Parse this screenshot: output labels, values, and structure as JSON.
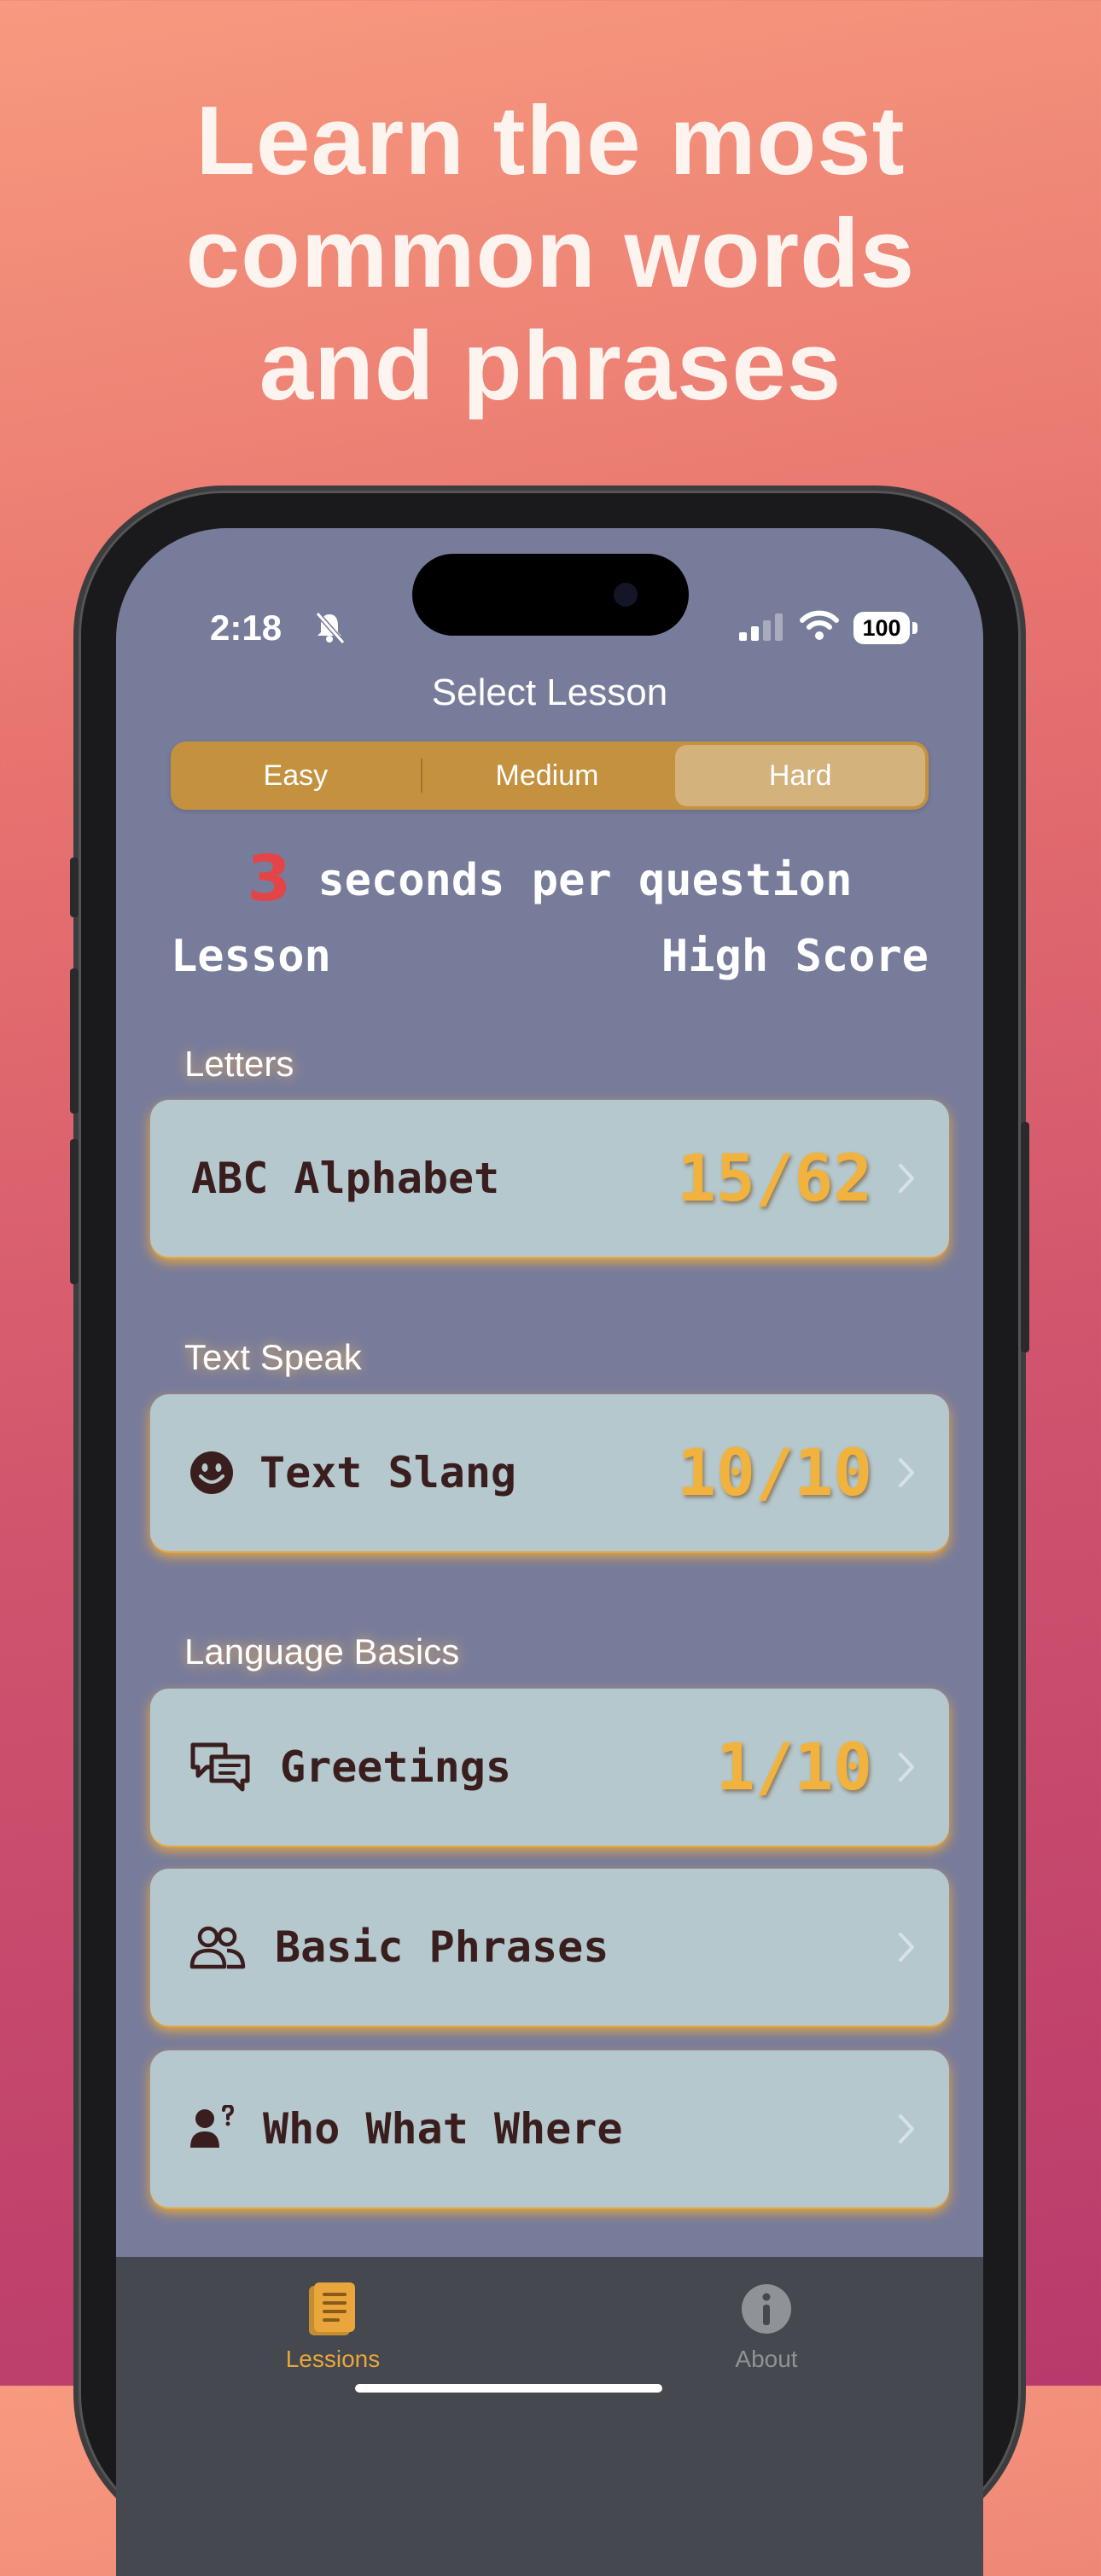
{
  "headline": {
    "line1": "Learn the most",
    "line2": "common words",
    "line3": "and phrases"
  },
  "status_bar": {
    "time": "2:18",
    "battery": "100"
  },
  "nav": {
    "title": "Select Lesson"
  },
  "difficulty": {
    "options": [
      "Easy",
      "Medium",
      "Hard"
    ],
    "selected": "Hard"
  },
  "timer": {
    "number": "3",
    "text": " seconds per question"
  },
  "columns": {
    "lesson": "Lesson",
    "high_score": "High Score"
  },
  "sections": [
    {
      "title": "Letters",
      "lessons": [
        {
          "label": "ABC Alphabet",
          "score": "15/62",
          "icon": "abc-text"
        }
      ]
    },
    {
      "title": "Text Speak",
      "lessons": [
        {
          "label": "Text Slang",
          "score": "10/10",
          "icon": "smiley-icon"
        }
      ]
    },
    {
      "title": "Language Basics",
      "lessons": [
        {
          "label": "Greetings",
          "score": "1/10",
          "icon": "chat-bubbles-icon"
        },
        {
          "label": "Basic Phrases",
          "score": "",
          "icon": "people-icon"
        },
        {
          "label": "Who What Where",
          "score": "",
          "icon": "person-question-icon"
        }
      ]
    }
  ],
  "tabbar": {
    "lessons_label": "Lessions",
    "about_label": "About",
    "active": "Lessions"
  },
  "colors": {
    "accent": "#f2b33e",
    "segment_bg": "#c4913f",
    "card_bg": "#b5c8cd",
    "screen_bg": "#787c9b",
    "timer_number": "#e44447"
  }
}
